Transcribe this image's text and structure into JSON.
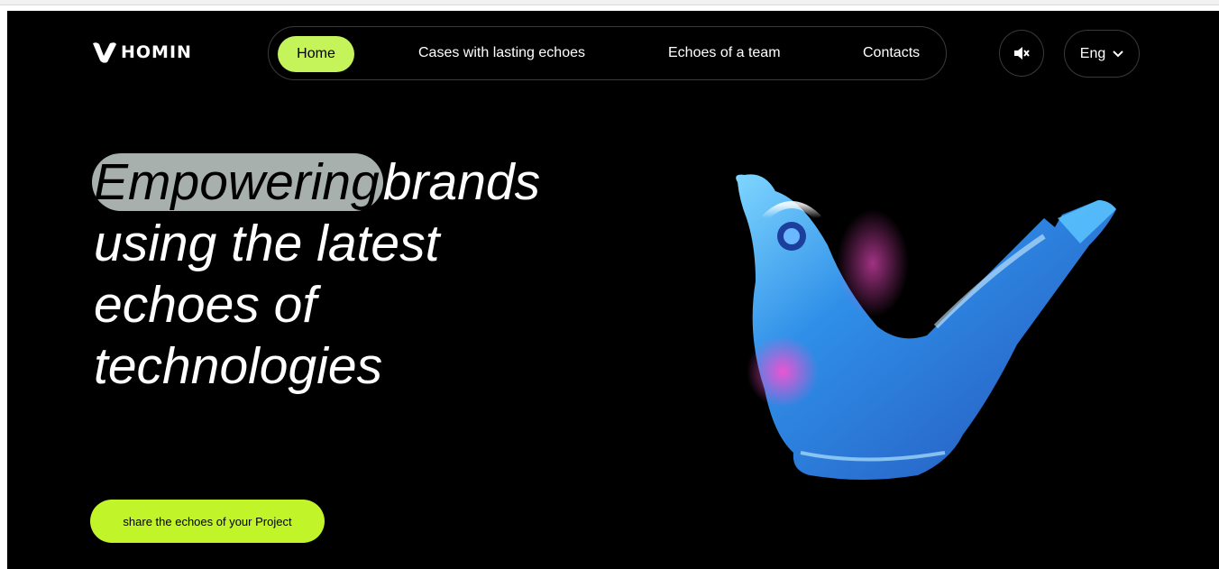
{
  "brand": {
    "name": "HOMIN"
  },
  "nav": {
    "items": [
      {
        "label": "Home",
        "active": true
      },
      {
        "label": "Cases with lasting echoes"
      },
      {
        "label": "Echoes of a team"
      },
      {
        "label": "Contacts"
      }
    ]
  },
  "controls": {
    "sound_icon": "speaker-muted-icon",
    "language": "Eng",
    "language_icon": "chevron-down-icon"
  },
  "hero": {
    "highlight": "Empowering",
    "rest_line1": "brands",
    "line2": "using the latest",
    "line3": "echoes of",
    "line4": "technologies"
  },
  "cta": {
    "label": "share the echoes of your Project"
  },
  "illustration": {
    "subject": "blue-bird-whistle-3d"
  },
  "colors": {
    "accent": "#c4f35a",
    "cta": "#c1f52a",
    "background": "#000000",
    "highlight": "#a8b0ae"
  }
}
